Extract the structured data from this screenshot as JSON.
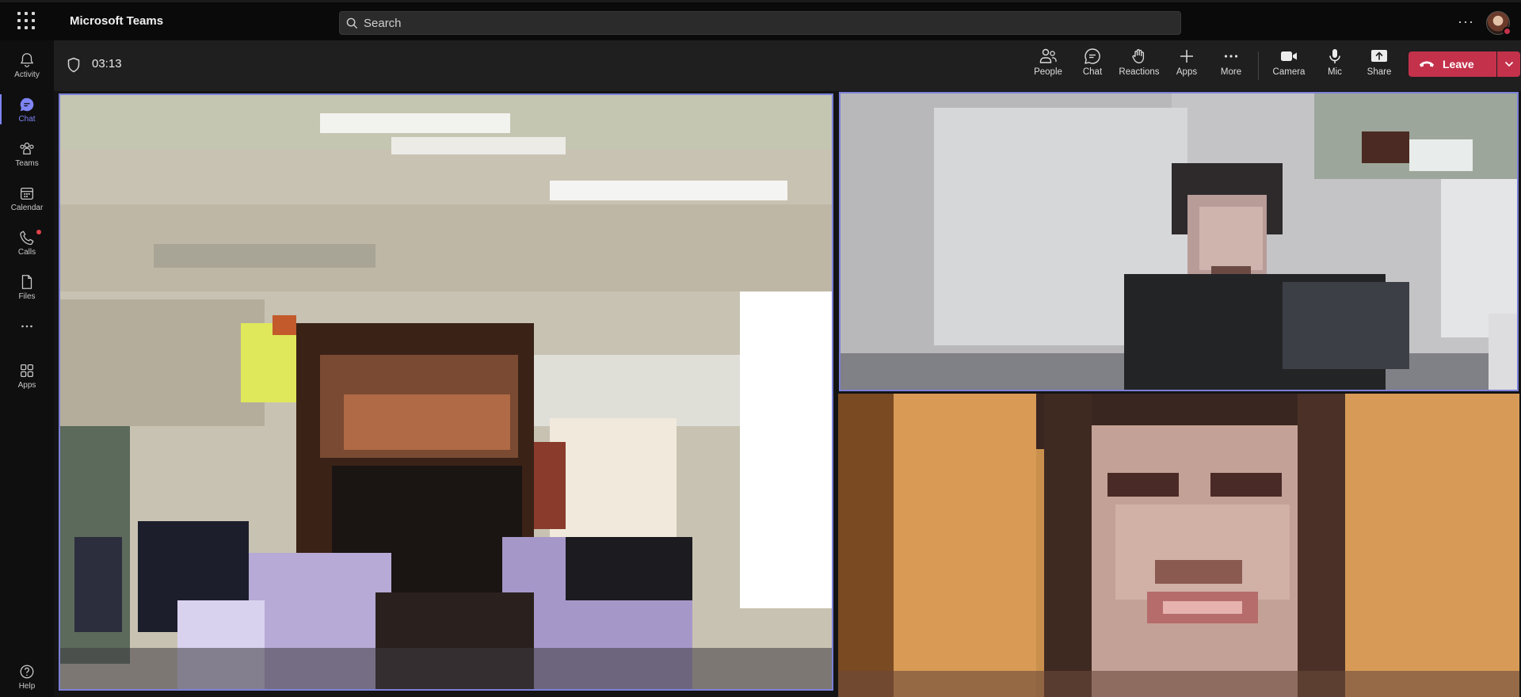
{
  "app": {
    "title": "Microsoft Teams"
  },
  "search": {
    "placeholder": "Search"
  },
  "rail": {
    "items": [
      {
        "label": "Activity",
        "icon": "bell-icon"
      },
      {
        "label": "Chat",
        "icon": "chat-icon",
        "active": true
      },
      {
        "label": "Teams",
        "icon": "teams-icon"
      },
      {
        "label": "Calendar",
        "icon": "calendar-icon"
      },
      {
        "label": "Calls",
        "icon": "phone-icon",
        "notification": true
      },
      {
        "label": "Files",
        "icon": "file-icon"
      },
      {
        "label": "",
        "icon": "more-horizontal-icon"
      },
      {
        "label": "Apps",
        "icon": "apps-icon"
      }
    ],
    "help": {
      "label": "Help",
      "icon": "help-icon"
    }
  },
  "meeting": {
    "timer": "03:13",
    "controls": {
      "people": "People",
      "chat": "Chat",
      "reactions": "Reactions",
      "apps": "Apps",
      "more": "More",
      "camera": "Camera",
      "mic": "Mic",
      "share": "Share"
    },
    "leave_label": "Leave"
  },
  "colors": {
    "accent": "#7f85f5",
    "leave": "#c4314b",
    "speaker_outline": "#7b80d8"
  }
}
